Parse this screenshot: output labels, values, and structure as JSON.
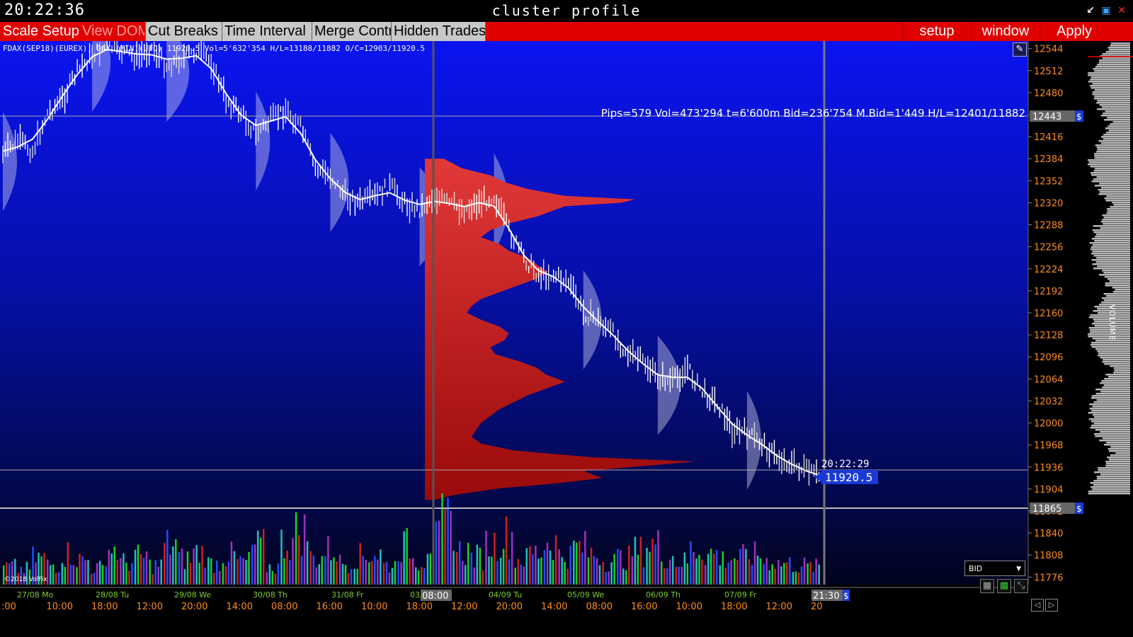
{
  "window": {
    "clock": "20:22:36",
    "title": "cluster profile"
  },
  "menu": {
    "scale_setup": "Scale Setup",
    "view_dom": "View DOM",
    "cut_breaks": "Cut Breaks",
    "time_interval": "Time Interval",
    "merge_contr": "Merge Contr",
    "hidden_trades": "Hidden Trades",
    "setup": "setup",
    "window": "window",
    "apply": "Apply"
  },
  "chart_info": {
    "symbol_line": "FDAX(SEP18)(EUREX), DAX   (MIN)(UTC)  11920.5  Vol=5'632'354  H/L=13188/11882  O/C=12903/11920.5",
    "range_stats": "Pips=579 Vol=473'294 t=6'600m Bid=236'754 M.Bid=1'449 H/L=12401/11882",
    "copyright": "©2018 VolFix",
    "last_time": "20:22:29",
    "last_price": "11920.5",
    "cursor_price_upper": "12443",
    "cursor_price_lower": "11865",
    "cursor_time_left": "08:00",
    "cursor_time_right": "21:30",
    "dollar_marker": "$",
    "bid_select": "BID",
    "volume_label": "VOLUME"
  },
  "colors": {
    "accent_red": "#e00000",
    "axis_orange": "#ff8c1a",
    "date_green": "#7ccd2a",
    "price_tag_blue": "#1a3ad8",
    "profile_red": "#dc3030"
  },
  "chart_data": {
    "type": "candlestick",
    "title": "",
    "y_ticks": [
      12544,
      12512,
      12480,
      12448,
      12416,
      12384,
      12352,
      12320,
      12288,
      12256,
      12224,
      12192,
      12160,
      12128,
      12096,
      12064,
      12032,
      12000,
      11968,
      11936,
      11904,
      11872,
      11840,
      11808,
      11776
    ],
    "ylim": [
      11765,
      12555
    ],
    "dates": [
      "27/08 Mo",
      "28/08 Tu",
      "29/08 We",
      "30/08 Th",
      "31/08 Fr",
      "03/09 Mo",
      "04/09 Tu",
      "05/09 We",
      "06/09 Th",
      "07/09 Fr"
    ],
    "times": [
      ":00",
      "10:00",
      "18:00",
      "12:00",
      "20:00",
      "14:00",
      "08:00",
      "16:00",
      "10:00",
      "18:00",
      "12:00",
      "20:00",
      "14:00",
      "08:00",
      "16:00",
      "10:00",
      "18:00",
      "12:00",
      "20"
    ],
    "price_path": [
      12390,
      12410,
      12395,
      12450,
      12470,
      12510,
      12535,
      12548,
      12540,
      12530,
      12545,
      12520,
      12530,
      12540,
      12525,
      12470,
      12450,
      12420,
      12440,
      12455,
      12430,
      12370,
      12360,
      12330,
      12320,
      12328,
      12345,
      12320,
      12310,
      12330,
      12318,
      12310,
      12320,
      12330,
      12280,
      12240,
      12215,
      12215,
      12205,
      12160,
      12150,
      12130,
      12100,
      12090,
      12065,
      12060,
      12080,
      12045,
      12030,
      11990,
      11985,
      11970,
      11950,
      11940,
      11930,
      11920.5
    ],
    "volume_values": [
      40,
      35,
      60,
      45,
      70,
      55,
      38,
      80,
      50,
      62,
      44,
      90,
      58,
      72,
      48,
      66,
      52,
      86,
      40,
      95,
      120,
      60,
      78,
      50,
      64,
      70,
      44,
      88,
      56,
      100,
      140,
      75,
      62,
      92,
      110,
      58,
      72,
      96,
      66,
      84,
      70,
      54,
      60,
      76,
      90,
      64,
      52,
      80,
      70,
      58,
      62,
      66,
      54,
      48,
      44,
      40
    ],
    "volume_profile": [
      [
        12384,
        20
      ],
      [
        12370,
        40
      ],
      [
        12360,
        70
      ],
      [
        12350,
        85
      ],
      [
        12340,
        110
      ],
      [
        12330,
        150
      ],
      [
        12325,
        225
      ],
      [
        12320,
        210
      ],
      [
        12315,
        150
      ],
      [
        12300,
        120
      ],
      [
        12290,
        90
      ],
      [
        12280,
        70
      ],
      [
        12270,
        60
      ],
      [
        12260,
        80
      ],
      [
        12250,
        90
      ],
      [
        12240,
        110
      ],
      [
        12230,
        120
      ],
      [
        12220,
        130
      ],
      [
        12210,
        120
      ],
      [
        12200,
        100
      ],
      [
        12190,
        80
      ],
      [
        12180,
        60
      ],
      [
        12170,
        50
      ],
      [
        12160,
        45
      ],
      [
        12150,
        60
      ],
      [
        12140,
        80
      ],
      [
        12130,
        90
      ],
      [
        12120,
        85
      ],
      [
        12110,
        70
      ],
      [
        12100,
        75
      ],
      [
        12090,
        100
      ],
      [
        12080,
        120
      ],
      [
        12070,
        130
      ],
      [
        12060,
        150
      ],
      [
        12050,
        130
      ],
      [
        12040,
        110
      ],
      [
        12030,
        95
      ],
      [
        12020,
        80
      ],
      [
        12010,
        70
      ],
      [
        12000,
        60
      ],
      [
        11990,
        55
      ],
      [
        11980,
        50
      ],
      [
        11970,
        60
      ],
      [
        11960,
        95
      ],
      [
        11950,
        180
      ],
      [
        11944,
        290
      ],
      [
        11938,
        240
      ],
      [
        11930,
        170
      ],
      [
        11920,
        190
      ],
      [
        11912,
        140
      ],
      [
        11905,
        80
      ],
      [
        11895,
        30
      ],
      [
        11888,
        10
      ]
    ]
  }
}
